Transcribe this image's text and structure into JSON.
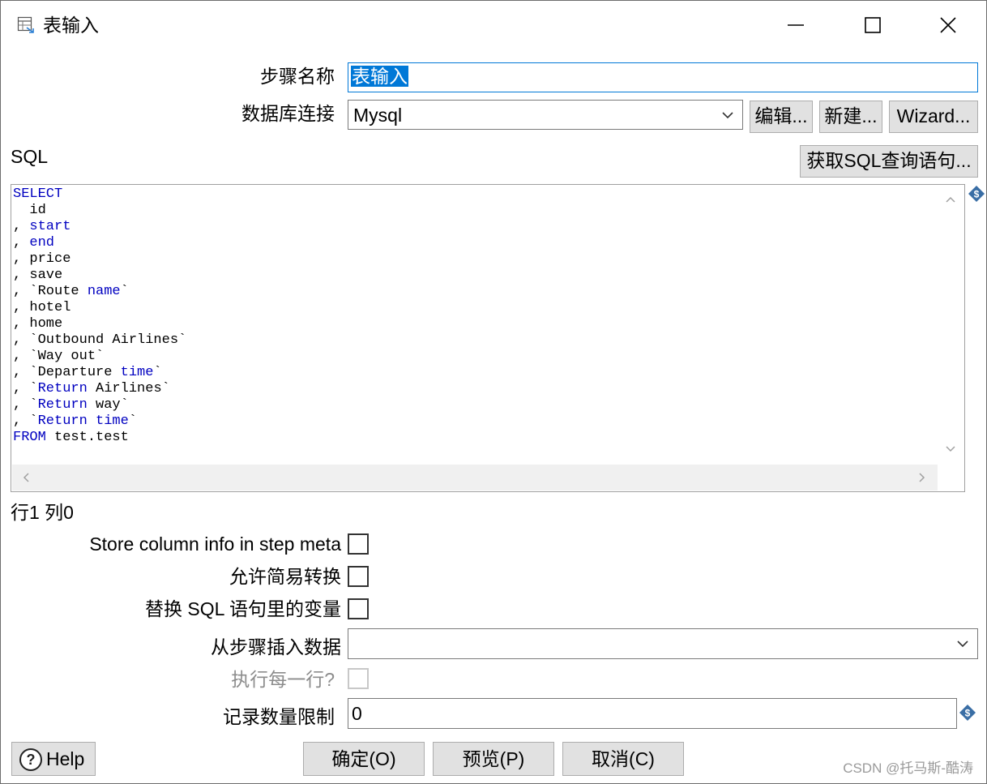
{
  "window": {
    "title": "表输入",
    "icon": "table-input-icon",
    "controls": [
      "minimize-icon",
      "maximize-icon",
      "close-icon"
    ]
  },
  "form": {
    "step_name_label": "步骤名称",
    "step_name_value": "表输入",
    "db_connection_label": "数据库连接",
    "db_connection_value": "Mysql",
    "edit_button": "编辑...",
    "new_button": "新建...",
    "wizard_button": "Wizard...",
    "sql_label": "SQL",
    "get_sql_button": "获取SQL查询语句..."
  },
  "sql_lines": [
    [
      {
        "t": "SELECT",
        "k": true
      }
    ],
    [
      {
        "t": "  id",
        "k": false
      }
    ],
    [
      {
        "t": ", ",
        "k": false
      },
      {
        "t": "start",
        "k": true
      }
    ],
    [
      {
        "t": ", ",
        "k": false
      },
      {
        "t": "end",
        "k": true
      }
    ],
    [
      {
        "t": ", price",
        "k": false
      }
    ],
    [
      {
        "t": ", save",
        "k": false
      }
    ],
    [
      {
        "t": ", `Route ",
        "k": false
      },
      {
        "t": "name",
        "k": true
      },
      {
        "t": "`",
        "k": false
      }
    ],
    [
      {
        "t": ", hotel",
        "k": false
      }
    ],
    [
      {
        "t": ", home",
        "k": false
      }
    ],
    [
      {
        "t": ", `Outbound Airlines`",
        "k": false
      }
    ],
    [
      {
        "t": ", `Way out`",
        "k": false
      }
    ],
    [
      {
        "t": ", `Departure ",
        "k": false
      },
      {
        "t": "time",
        "k": true
      },
      {
        "t": "`",
        "k": false
      }
    ],
    [
      {
        "t": ", `",
        "k": false
      },
      {
        "t": "Return",
        "k": true
      },
      {
        "t": " Airlines`",
        "k": false
      }
    ],
    [
      {
        "t": ", `",
        "k": false
      },
      {
        "t": "Return",
        "k": true
      },
      {
        "t": " way`",
        "k": false
      }
    ],
    [
      {
        "t": ", `",
        "k": false
      },
      {
        "t": "Return",
        "k": true
      },
      {
        "t": " ",
        "k": false
      },
      {
        "t": "time",
        "k": true
      },
      {
        "t": "`",
        "k": false
      }
    ],
    [
      {
        "t": "FROM",
        "k": true
      },
      {
        "t": " test.test",
        "k": false
      }
    ]
  ],
  "status": {
    "cursor_position": "行1 列0"
  },
  "options": {
    "store_column_info_label": "Store column info in step meta",
    "store_column_info_checked": false,
    "lazy_conversion_label": "允许简易转换",
    "lazy_conversion_checked": false,
    "replace_variables_label": "替换 SQL 语句里的变量",
    "replace_variables_checked": false,
    "insert_from_step_label": "从步骤插入数据",
    "insert_from_step_value": "",
    "execute_each_row_label": "执行每一行?",
    "execute_each_row_checked": false,
    "limit_label": "记录数量限制",
    "limit_value": "0"
  },
  "footer": {
    "help_button": "Help",
    "ok_button": "确定(O)",
    "preview_button": "预览(P)",
    "cancel_button": "取消(C)"
  },
  "watermark": "CSDN @托马斯-酷涛",
  "colors": {
    "accent": "#0078d7",
    "keyword": "#0000c0",
    "button_bg": "#e1e1e1",
    "variable_icon": "#3a6ea5"
  }
}
